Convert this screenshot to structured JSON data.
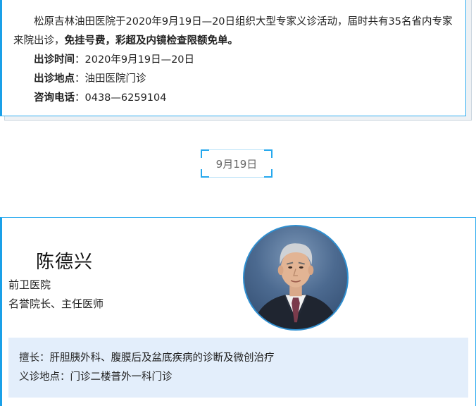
{
  "notice": {
    "intro_text": "松原吉林油田医院于2020年9月19日—20日组织大型专家义诊活动，届时共有35名省内专家来院出诊，",
    "intro_bold": "免挂号费，彩超及内镜检查限额免单。",
    "time_label": "出诊时间",
    "time_value": "：2020年9月19日—20日",
    "place_label": "出诊地点",
    "place_value": "：油田医院门诊",
    "phone_label": "咨询电话",
    "phone_value": "：0438—6259104"
  },
  "date_tag": "9月19日",
  "doctor": {
    "name": "陈德兴",
    "hospital": "前卫医院",
    "title": "名誉院长、主任医师",
    "specialty": "擅长：肝胆胰外科、腹膜后及盆底疾病的诊断及微创治疗",
    "location": "义诊地点：门诊二楼普外一科门诊"
  }
}
